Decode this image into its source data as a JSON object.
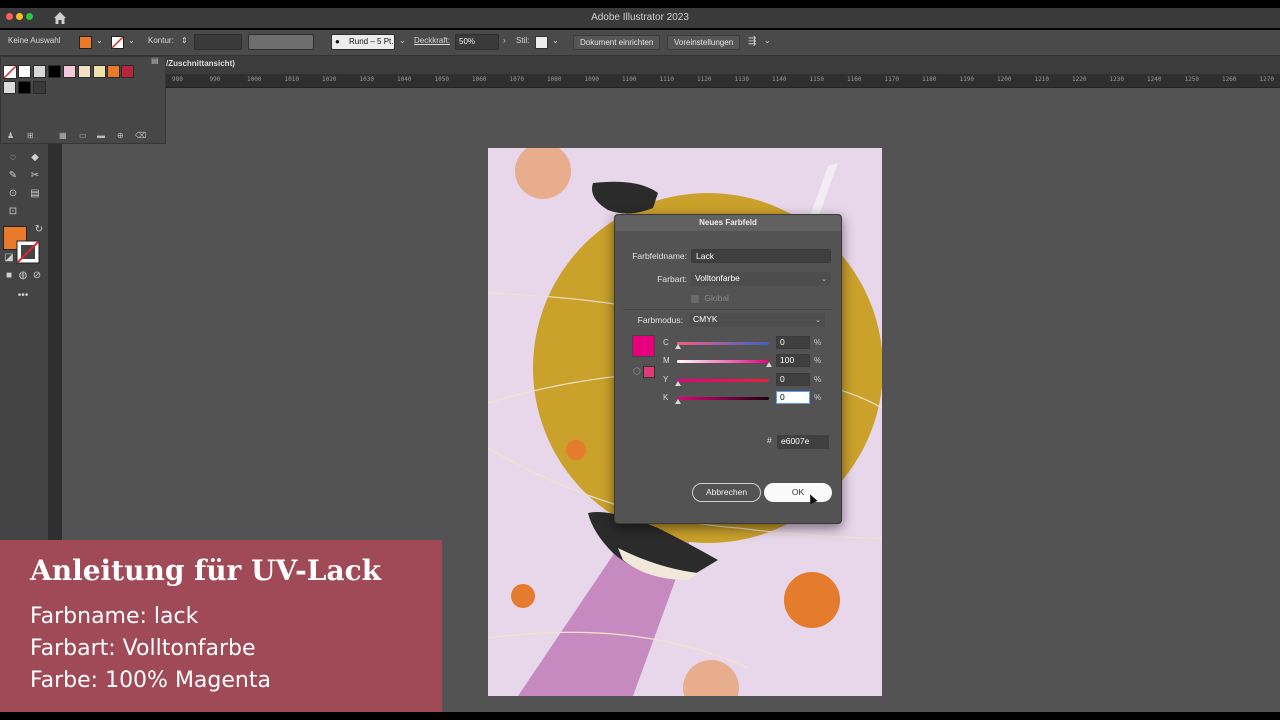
{
  "app": {
    "title": "Adobe Illustrator 2023"
  },
  "control_bar": {
    "selection": "Keine Auswahl",
    "stroke_label": "Kontur:",
    "brush": "Rund – 5 Pt.",
    "opacity_label": "Deckkraft:",
    "opacity_value": "50%",
    "style_label": "Stil:",
    "doc_setup_button": "Dokument einrichten",
    "preferences_button": "Voreinstellungen",
    "fill_color": "#e87a2a"
  },
  "document": {
    "tab_title": "/Zuschnittansicht)"
  },
  "ruler": {
    "ticks": [
      "980",
      "990",
      "1000",
      "1010",
      "1020",
      "1030",
      "1040",
      "1050",
      "1060",
      "1070",
      "1080",
      "1090",
      "1100",
      "1110",
      "1120",
      "1130",
      "1140",
      "1150",
      "1160",
      "1170",
      "1180",
      "1190",
      "1200",
      "1210",
      "1220",
      "1230",
      "1240",
      "1250",
      "1260",
      "1270"
    ]
  },
  "swatches": {
    "colors": [
      "#ffffff",
      "#d8d8d8",
      "#000000",
      "#f3c8d8",
      "#f4e0c2",
      "#efe2a8",
      "#e87a2a",
      "#b8263e",
      "#dcdcdc",
      "#000000",
      "#3a3a3a"
    ]
  },
  "dialog": {
    "title": "Neues Farbfeld",
    "name_label": "Farbfeldname:",
    "name_value": "Lack",
    "type_label": "Farbart:",
    "type_value": "Volltonfarbe",
    "global_label": "Global",
    "mode_label": "Farbmodus:",
    "mode_value": "CMYK",
    "channels": [
      {
        "label": "C",
        "value": "0"
      },
      {
        "label": "M",
        "value": "100"
      },
      {
        "label": "Y",
        "value": "0"
      },
      {
        "label": "K",
        "value": "0"
      }
    ],
    "percent": "%",
    "hash": "#",
    "hex_value": "e6007e",
    "cancel_button": "Abbrechen",
    "ok_button": "OK",
    "preview_color": "#e6007e"
  },
  "caption": {
    "title": "Anleitung für UV-Lack",
    "line1": "Farbname: lack",
    "line2": "Farbart: Volltonfarbe",
    "line3": "Farbe: 100% Magenta"
  }
}
